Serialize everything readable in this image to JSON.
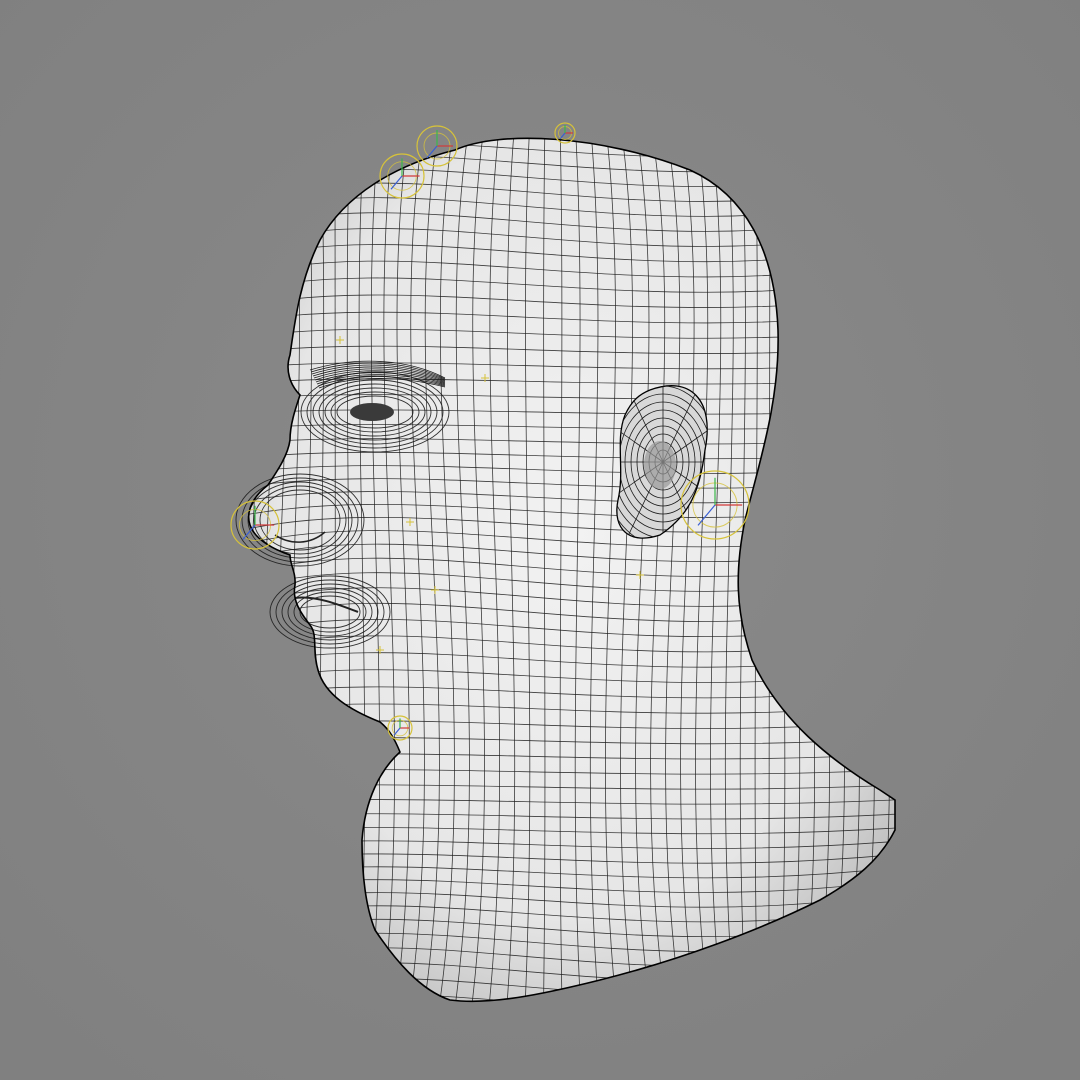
{
  "viewport": {
    "background_color": "#808080",
    "background_center_color": "#8a8a8a",
    "mesh_fill_color": "#e6e6e6",
    "mesh_shade_color": "#b9b9b9",
    "wire_color": "#1c1c1c",
    "outline_color": "#000000",
    "rig_control_color": "#d6c23a",
    "axis_colors": [
      "#d23a3a",
      "#3a5fd2",
      "#3ab84a"
    ],
    "rig_controls": [
      "head-top",
      "crown",
      "nose-tip",
      "ear-left",
      "chin",
      "brow"
    ]
  }
}
